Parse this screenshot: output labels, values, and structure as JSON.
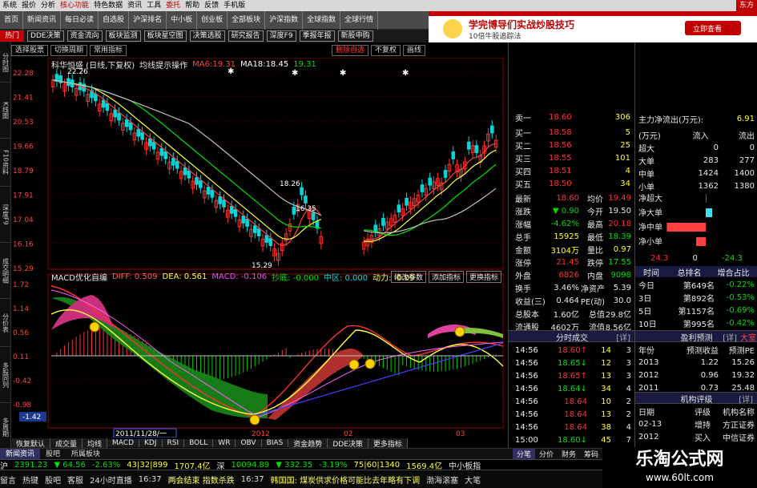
{
  "menu": [
    "系统",
    "报价",
    "分析",
    "核心功能",
    "特色数据",
    "资讯",
    "工具",
    "委托",
    "帮助",
    "反馈",
    "手机版"
  ],
  "menu_hot_index": [
    3,
    7
  ],
  "brand": "东方",
  "nav1": [
    "首页",
    "新闻资讯",
    "每日必读",
    "自选股",
    "沪深排名",
    "中小板",
    "创业板",
    "全部板块",
    "沪深指数",
    "全球指数",
    "全球行情"
  ],
  "nav2_hot": "热门",
  "nav2": [
    "DDE决策",
    "资金流向",
    "板块监测",
    "板块星空图",
    "决策选股",
    "研究报告",
    "深度F9",
    "季报年报",
    "新股申购"
  ],
  "ad": {
    "title": "学完博导们实战炒股技巧",
    "sub": "10倍牛股追踪法",
    "button": "立即查看"
  },
  "sidebar": [
    "分时图",
    "K线图",
    "F10资料",
    "深度F9",
    "成交明细",
    "分价表",
    "多股同列",
    "多周期"
  ],
  "ctool": [
    "选择股票",
    "切换周期",
    "常用指标"
  ],
  "ctool_right": [
    "删除自选",
    "不复权",
    "画线"
  ],
  "kline": {
    "title": "科华恒盛 (日线,下复权)",
    "indicator": "均线提示操作",
    "ma": [
      {
        "label": "MA6:",
        "value": "19.31",
        "color": "#ff4040"
      },
      {
        "label": "MA18:",
        "value": "18.45",
        "color": "#ffffff"
      },
      {
        "label": "",
        "value": "19.31",
        "color": "#00e000"
      }
    ],
    "yticks": [
      "22.28",
      "21.41",
      "20.53",
      "19.66",
      "18.79",
      "17.91",
      "17.04",
      "16.16",
      "15.29"
    ],
    "annotations": [
      "22.26",
      "18.26",
      "16.35",
      "15.29"
    ]
  },
  "macd": {
    "title": "MACD优化自编",
    "diff": "DIFF: 0.509",
    "dea": "DEA: 0.561",
    "macd": "MACD: -0.106",
    "bottom": "抄底: -0.000",
    "mid": "中区: 0.000",
    "power": "动力: -0.09",
    "buttons": [
      "修改参数",
      "添加指标",
      "更换指标"
    ],
    "yticks": [
      "1.72",
      "1.14",
      "0.56",
      "0.11",
      "-0.42",
      "-0.98"
    ],
    "current": "-1.42"
  },
  "xaxis": [
    "2011/11/28/一",
    "2012",
    "02",
    "03"
  ],
  "itabs": [
    "恢复默认",
    "成交量",
    "均线",
    "MACD",
    "KDJ",
    "RSI",
    "BOLL",
    "WR",
    "OBV",
    "BIAS",
    "资金趋势",
    "DDE决策",
    "更多指标"
  ],
  "sell": {
    "label": "卖一",
    "price": "18.60",
    "vol": "306"
  },
  "buys": [
    {
      "label": "买一",
      "price": "18.58",
      "vol": "5"
    },
    {
      "label": "买二",
      "price": "18.56",
      "vol": "25"
    },
    {
      "label": "买三",
      "price": "18.55",
      "vol": "101"
    },
    {
      "label": "买四",
      "price": "18.51",
      "vol": "4"
    },
    {
      "label": "买五",
      "price": "18.50",
      "vol": "34"
    }
  ],
  "stats": [
    {
      "k1": "最新",
      "v1": "18.60",
      "c1": "red",
      "k2": "均价",
      "v2": "19.49",
      "c2": "red"
    },
    {
      "k1": "涨跌",
      "v1": "▼ 0.90",
      "c1": "grn",
      "k2": "今开",
      "v2": "19.50",
      "c2": "wht"
    },
    {
      "k1": "涨幅",
      "v1": "-4.62%",
      "c1": "grn",
      "k2": "最高",
      "v2": "20.18",
      "c2": "red"
    },
    {
      "k1": "总手",
      "v1": "15925",
      "c1": "yel",
      "k2": "最低",
      "v2": "18.39",
      "c2": "grn"
    },
    {
      "k1": "金额",
      "v1": "3104万",
      "c1": "yel",
      "k2": "量比",
      "v2": "0.97",
      "c2": "yel"
    },
    {
      "k1": "涨停",
      "v1": "21.45",
      "c1": "red",
      "k2": "跌停",
      "v2": "17.55",
      "c2": "grn"
    },
    {
      "k1": "外盘",
      "v1": "6826",
      "c1": "red",
      "k2": "内盘",
      "v2": "9098",
      "c2": "grn"
    }
  ],
  "fin": [
    {
      "k1": "换手",
      "v1": "3.46%",
      "k2": "净资产",
      "v2": "5.39"
    },
    {
      "k1": "收益(三)",
      "v1": "0.464",
      "k2": "PE(动)",
      "v2": "30.0"
    },
    {
      "k1": "总股本",
      "v1": "1.60亿",
      "k2": "总值",
      "v2": "29.8亿"
    },
    {
      "k1": "流通股",
      "v1": "4602万",
      "k2": "流值",
      "v2": "8.56亿"
    }
  ],
  "ticks_header": "分时成交",
  "ticks_detail": "[详]",
  "ticks": [
    {
      "t": "14:56",
      "p": "18.60",
      "a": "↑",
      "v": "14",
      "n": "3"
    },
    {
      "t": "14:56",
      "p": "18.65",
      "a": "↓",
      "v": "12",
      "n": "3"
    },
    {
      "t": "14:56",
      "p": "18.65",
      "a": "↑",
      "v": "13",
      "n": "3"
    },
    {
      "t": "14:56",
      "p": "18.64",
      "a": "↓",
      "v": "34",
      "n": "4"
    },
    {
      "t": "14:56",
      "p": "18.64",
      "a": "",
      "v": "10",
      "n": "2"
    },
    {
      "t": "14:56",
      "p": "18.64",
      "a": "",
      "v": "13",
      "n": "2"
    },
    {
      "t": "14:56",
      "p": "18.64",
      "a": "",
      "v": "38",
      "n": "4"
    },
    {
      "t": "15:00",
      "p": "18.60",
      "a": "↓",
      "v": "45",
      "n": "7"
    }
  ],
  "flow": {
    "title": "主力净流出(万元):",
    "value": "6.91",
    "unit": "(万元)",
    "in_label": "流入",
    "out_label": "流出",
    "rows": [
      {
        "k": "超大",
        "in": "0",
        "out": "0"
      },
      {
        "k": "大单",
        "in": "283",
        "out": "277"
      },
      {
        "k": "中单",
        "in": "1424",
        "out": "1400"
      },
      {
        "k": "小单",
        "in": "1362",
        "out": "1380"
      }
    ],
    "net_labels": [
      "净超大",
      "净大单",
      "净中单",
      "净小单"
    ],
    "net_values": [
      0,
      4,
      -24.3,
      -6
    ],
    "net_left": "24.3",
    "net_right": "-24.3"
  },
  "tabs_right": [
    "时间",
    "总排名",
    "增合占比"
  ],
  "rank": [
    {
      "k": "今日",
      "v": "第649名",
      "p": "-0.22%"
    },
    {
      "k": "3日",
      "v": "第892名",
      "p": "-0.53%"
    },
    {
      "k": "5日",
      "v": "第1157名",
      "p": "-0.69%"
    },
    {
      "k": "10日",
      "v": "第995名",
      "p": "-0.42%"
    }
  ],
  "forecast": {
    "title": "盈利预测",
    "detail": "[详]",
    "more": "大室",
    "h": [
      "年份",
      "预测收益",
      "预测PE"
    ],
    "rows": [
      [
        "2013",
        "1.22",
        "15.26"
      ],
      [
        "2012",
        "0.96",
        "19.32"
      ],
      [
        "2011",
        "0.73",
        "25.48"
      ]
    ]
  },
  "rating": {
    "title": "机构评级",
    "detail": "[详]",
    "h": [
      "日期",
      "评级",
      "机构名称"
    ],
    "rows": [
      [
        "02-13",
        "增持",
        "方正证券"
      ],
      [
        "2012",
        "买入",
        "中信证券"
      ]
    ]
  },
  "rtabs": [
    "分笔",
    "分价",
    "财务",
    "筹码",
    "大笔"
  ],
  "btabs": [
    "新闻资讯",
    "股吧",
    "所属板块"
  ],
  "status": [
    {
      "t": "沪",
      "c": "wht"
    },
    {
      "t": "2391.23",
      "c": "grn"
    },
    {
      "t": "▼ 64.56",
      "c": "grn"
    },
    {
      "t": "-2.63%",
      "c": "grn"
    },
    {
      "t": "43|32|899",
      "c": "yel"
    },
    {
      "t": "1707.4亿",
      "c": "yel"
    },
    {
      "t": "深",
      "c": "wht"
    },
    {
      "t": "10094.89",
      "c": "grn"
    },
    {
      "t": "▼ 332.35",
      "c": "grn"
    },
    {
      "t": "-3.19%",
      "c": "grn"
    },
    {
      "t": "75|60|1340",
      "c": "yel"
    },
    {
      "t": "1569.4亿",
      "c": "yel"
    },
    {
      "t": "中小板指",
      "c": "wht"
    }
  ],
  "ticker": [
    "留言",
    "热键",
    "股吧",
    "客服",
    "24小时直播",
    "16:37",
    "两会结束 指数杀跌",
    "16:37",
    "韩国国: 煤炭供求价格可能比去年略有下调",
    "渤海滚塞",
    "大笔"
  ],
  "watermark": {
    "cn": "乐淘公式网",
    "url": "www.60lt.com"
  }
}
